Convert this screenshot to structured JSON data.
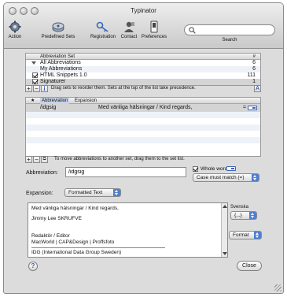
{
  "window": {
    "title": "Typinator"
  },
  "toolbar": {
    "action": "Action",
    "predefined_sets": "Predefined Sets",
    "registration": "Registration",
    "contact": "Contact",
    "preferences": "Preferences",
    "search_label": "Search",
    "search_value": "",
    "search_placeholder": ""
  },
  "sets_table": {
    "col_name": "Abbreviation Set",
    "col_count": "#",
    "rows": [
      {
        "name": "All Abbreviations",
        "count": "6"
      },
      {
        "name": "My Abbreviations",
        "count": "6"
      },
      {
        "name": "HTML Snippets 1.0",
        "count": "111"
      },
      {
        "name": "Signaturer",
        "count": "1"
      }
    ],
    "hint": "Drag sets to reorder them. Sets at the top of the list take precedence."
  },
  "abbr_table": {
    "col_abbreviation": "Abbreviation",
    "col_expansion": "Expansion",
    "rows": [
      {
        "abbreviation": "/idgsig",
        "expansion": "Med vänliga hälsningar / Kind regards,"
      }
    ],
    "hint": "To move abbreviations to another set, drag them to the set list."
  },
  "abbreviation": {
    "label": "Abbreviation:",
    "value": "/idgsig",
    "whole_word": "Whole word",
    "case_option": "Case must match (=)"
  },
  "expansion": {
    "label": "Expansion:",
    "type": "Formatted Text",
    "lines": [
      "Med vänliga hälsningar / Kind regards,",
      "Jimmy Lee SKRUFVE",
      "Redaktör / Editor",
      "MacWorld  |  CAP&Design  |  Proffsfoto",
      "IDG (International Data Group Sweden)"
    ],
    "language": "Svenska",
    "insert_menu": "{...}",
    "format_button": "Format"
  },
  "footer": {
    "help": "?",
    "close": "Close"
  },
  "colors": {
    "accent": "#4f7fd1",
    "window_bg": "#dcdcdc",
    "row_alt": "#eef2f8"
  }
}
